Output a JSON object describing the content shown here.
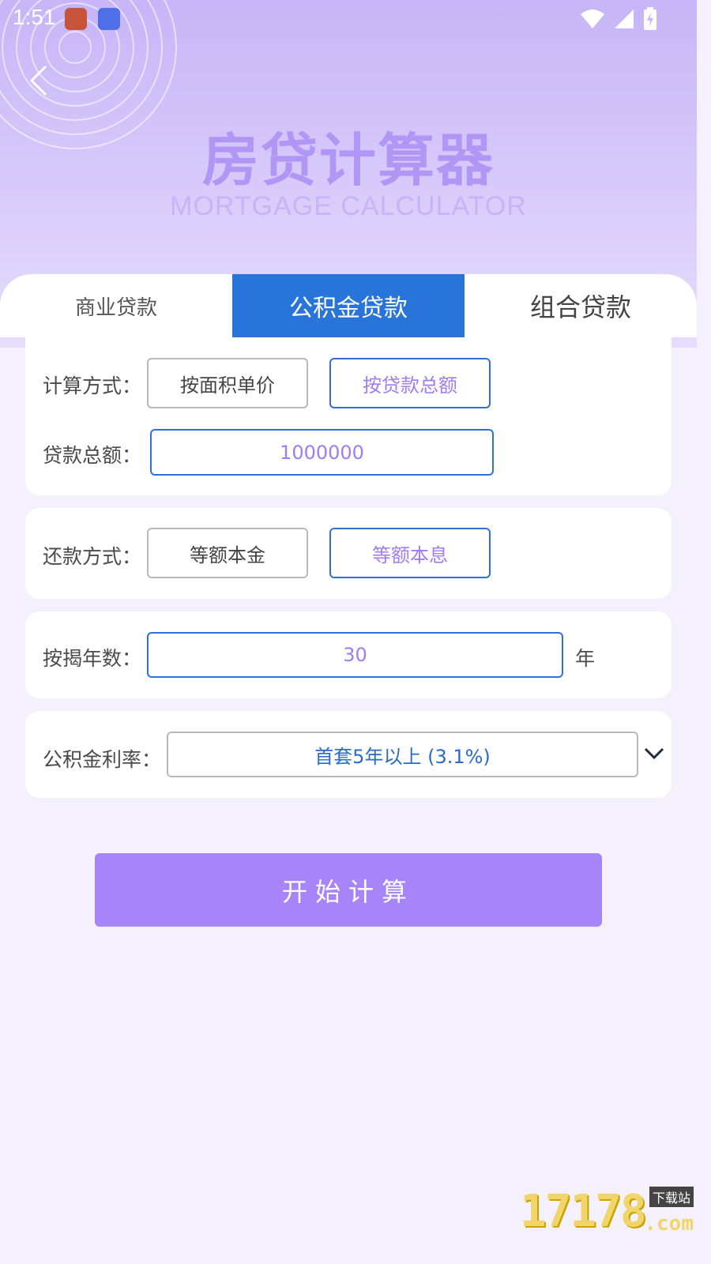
{
  "status_bar": {
    "time": "1:51"
  },
  "header": {
    "title": "房贷计算器",
    "subtitle": "MORTGAGE CALCULATOR"
  },
  "tabs": [
    {
      "label": "商业贷款",
      "active": false
    },
    {
      "label": "公积金贷款",
      "active": true
    },
    {
      "label": "组合贷款",
      "active": false
    }
  ],
  "calc_method": {
    "label": "计算方式：",
    "options": [
      "按面积单价",
      "按贷款总额"
    ],
    "selected": "按贷款总额"
  },
  "loan_total": {
    "label": "贷款总额：",
    "value": "1000000"
  },
  "repay_method": {
    "label": "还款方式：",
    "options": [
      "等额本金",
      "等额本息"
    ],
    "selected": "等额本息"
  },
  "years": {
    "label": "按揭年数：",
    "value": "30",
    "unit": "年"
  },
  "rate": {
    "label": "公积金利率：",
    "value": "首套5年以上 (3.1%)"
  },
  "submit": {
    "label": "开始计算"
  },
  "watermark": {
    "number": "17178",
    "tag": "下载站",
    "suffix": ".com"
  },
  "colors": {
    "accent": "#2874d8",
    "purple": "#a784f8",
    "selected_text": "#a07cf0"
  }
}
